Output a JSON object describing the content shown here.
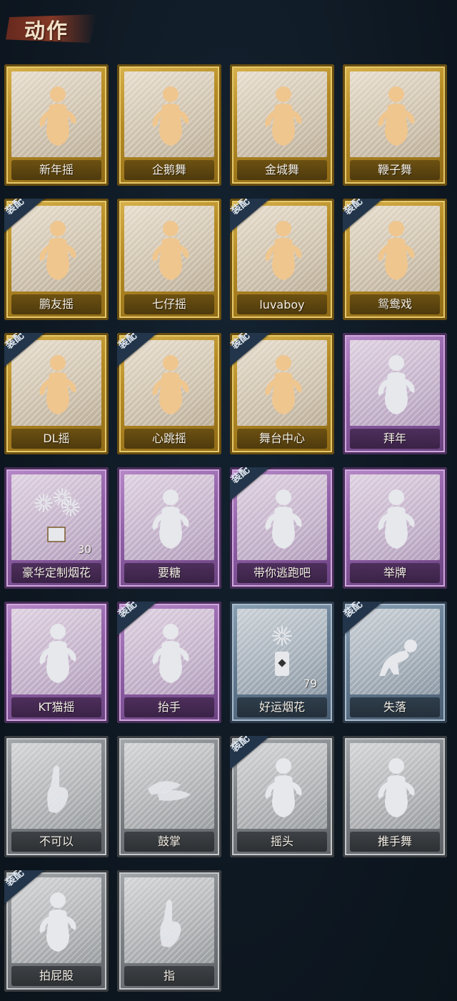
{
  "header": {
    "title": "动作"
  },
  "badge_label": "装配",
  "colors": {
    "gold": "#c9a13a",
    "purple": "#9a6bb0",
    "blue": "#6b8297",
    "gray": "#8a8e92",
    "figure_gold": "#f0c68f",
    "figure_silver": "#e6e8ec"
  },
  "cards": [
    {
      "name": "新年摇",
      "tier": "gold",
      "equipped": false,
      "icon": "figure-shake-icon"
    },
    {
      "name": "企鹅舞",
      "tier": "gold",
      "equipped": false,
      "icon": "figure-penguin-dance-icon"
    },
    {
      "name": "金城舞",
      "tier": "gold",
      "equipped": false,
      "icon": "figure-dance-icon"
    },
    {
      "name": "鞭子舞",
      "tier": "gold",
      "equipped": false,
      "icon": "figure-whip-dance-icon"
    },
    {
      "name": "鹏友摇",
      "tier": "gold",
      "equipped": true,
      "icon": "figure-shake-icon"
    },
    {
      "name": "七仔摇",
      "tier": "gold",
      "equipped": false,
      "icon": "figure-shake-icon"
    },
    {
      "name": "luvaboy",
      "tier": "gold",
      "equipped": true,
      "icon": "figure-dance-icon"
    },
    {
      "name": "鸳鸯戏",
      "tier": "gold",
      "equipped": true,
      "icon": "figure-dance-icon"
    },
    {
      "name": "DL摇",
      "tier": "gold",
      "equipped": true,
      "icon": "figure-arm-raise-icon"
    },
    {
      "name": "心跳摇",
      "tier": "gold",
      "equipped": true,
      "icon": "figure-heartbeat-icon"
    },
    {
      "name": "舞台中心",
      "tier": "gold",
      "equipped": true,
      "icon": "figure-dance-icon"
    },
    {
      "name": "拜年",
      "tier": "purple",
      "equipped": false,
      "icon": "figure-bow-icon"
    },
    {
      "name": "豪华定制烟花",
      "tier": "purple",
      "equipped": false,
      "icon": "fireworks-box-icon",
      "count": "30"
    },
    {
      "name": "要糖",
      "tier": "purple",
      "equipped": false,
      "icon": "figure-ask-icon"
    },
    {
      "name": "带你逃跑吧",
      "tier": "purple",
      "equipped": true,
      "icon": "figure-point-icon"
    },
    {
      "name": "举牌",
      "tier": "purple",
      "equipped": false,
      "icon": "figure-sign-icon"
    },
    {
      "name": "KT猫摇",
      "tier": "purple",
      "equipped": false,
      "icon": "figure-shake-icon"
    },
    {
      "name": "抬手",
      "tier": "purple",
      "equipped": true,
      "icon": "figure-raise-hand-icon"
    },
    {
      "name": "好运烟花",
      "tier": "blue",
      "equipped": false,
      "icon": "firework-can-icon",
      "count": "79"
    },
    {
      "name": "失落",
      "tier": "blue",
      "equipped": true,
      "icon": "figure-crawl-icon"
    },
    {
      "name": "不可以",
      "tier": "gray",
      "equipped": false,
      "icon": "finger-wag-icon"
    },
    {
      "name": "鼓掌",
      "tier": "gray",
      "equipped": false,
      "icon": "clapping-hands-icon"
    },
    {
      "name": "摇头",
      "tier": "gray",
      "equipped": true,
      "icon": "figure-shake-head-icon"
    },
    {
      "name": "推手舞",
      "tier": "gray",
      "equipped": false,
      "icon": "figure-push-dance-icon"
    },
    {
      "name": "拍屁股",
      "tier": "gray",
      "equipped": true,
      "icon": "figure-spank-icon"
    },
    {
      "name": "指",
      "tier": "gray",
      "equipped": false,
      "icon": "pointing-hand-icon"
    }
  ]
}
